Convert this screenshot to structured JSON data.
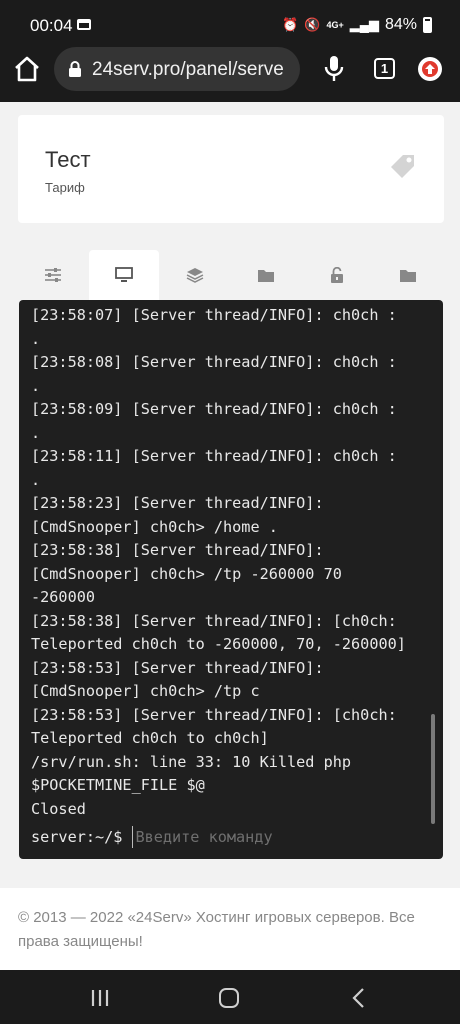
{
  "status_bar": {
    "time": "00:04",
    "network": "4G+",
    "battery": "84%"
  },
  "browser": {
    "url": "24serv.pro/panel/serve",
    "tab_count": "1"
  },
  "card": {
    "title": "Тест",
    "subtitle": "Тариф"
  },
  "tabs": [
    {
      "icon": "sliders-icon",
      "active": false
    },
    {
      "icon": "monitor-icon",
      "active": true
    },
    {
      "icon": "layers-icon",
      "active": false
    },
    {
      "icon": "folder-icon",
      "active": false
    },
    {
      "icon": "unlock-icon",
      "active": false
    },
    {
      "icon": "folder-icon",
      "active": false
    }
  ],
  "console": {
    "lines": [
      "[23:58:07] [Server thread/INFO]: ch0ch :",
      ".",
      "[23:58:08] [Server thread/INFO]: ch0ch :",
      ".",
      "[23:58:09] [Server thread/INFO]: ch0ch :",
      ".",
      "[23:58:11] [Server thread/INFO]: ch0ch :",
      ".",
      "[23:58:23] [Server thread/INFO]:",
      "[CmdSnooper] ch0ch> /home .",
      "[23:58:38] [Server thread/INFO]:",
      "[CmdSnooper] ch0ch> /tp -260000 70",
      "-260000",
      "[23:58:38] [Server thread/INFO]: [ch0ch:",
      "Teleported ch0ch to -260000, 70, -260000]",
      "[23:58:53] [Server thread/INFO]:",
      "[CmdSnooper] ch0ch> /tp c",
      "[23:58:53] [Server thread/INFO]: [ch0ch:",
      "Teleported ch0ch to ch0ch]",
      "/srv/run.sh: line 33: 10 Killed php",
      "$POCKETMINE_FILE $@",
      "Closed"
    ],
    "prompt": "server:~/$",
    "input_placeholder": "Введите команду"
  },
  "footer": {
    "text": "© 2013 — 2022 «24Serv» Хостинг игровых серверов. Все права защищены!"
  },
  "colors": {
    "page_bg": "#f2f2f2",
    "terminal_bg": "#1f1f1f",
    "system_bar": "#1b1b1b",
    "ext_accent": "#e03a2e"
  }
}
